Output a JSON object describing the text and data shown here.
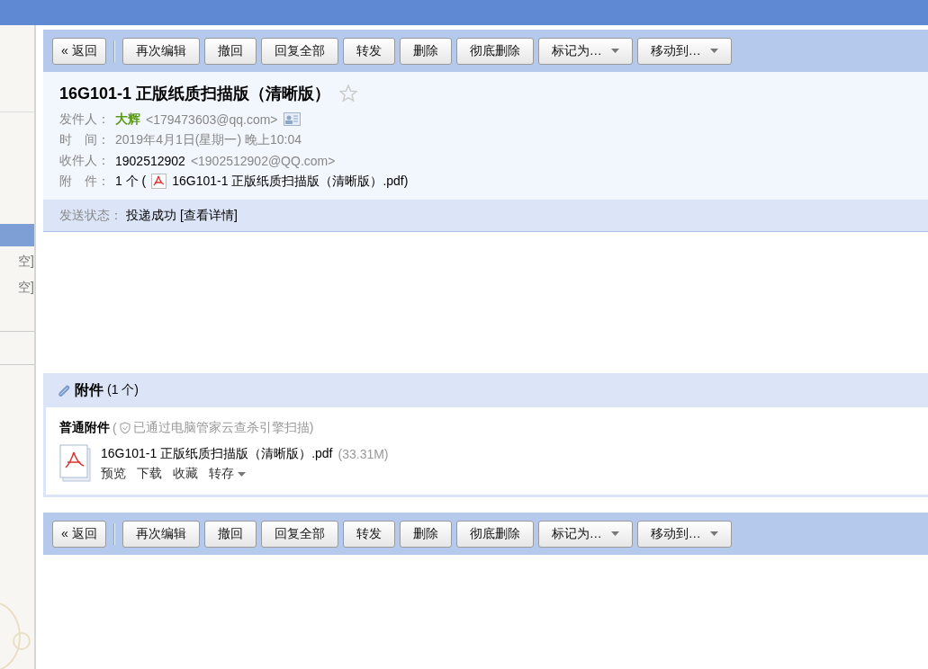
{
  "sidebar": {
    "items": [
      {
        "selected": true
      },
      {
        "label": "空]",
        "selected": false
      },
      {
        "label": "空]",
        "selected": false
      }
    ]
  },
  "top_toolbar": {
    "buttons": [
      {
        "label": "« 返回",
        "kind": "plain"
      },
      {
        "label": "再次编辑",
        "kind": "plain"
      },
      {
        "label": "撤回",
        "kind": "plain"
      },
      {
        "label": "回复全部",
        "kind": "plain"
      },
      {
        "label": "转发",
        "kind": "plain"
      },
      {
        "label": "删除",
        "kind": "plain"
      },
      {
        "label": "彻底删除",
        "kind": "plain"
      },
      {
        "label": "标记为…",
        "kind": "dropdown"
      },
      {
        "label": "移动到…",
        "kind": "dropdown"
      }
    ]
  },
  "mail": {
    "subject": "16G101-1 正版纸质扫描版（清晰版）",
    "starred": false,
    "fields": [
      {
        "kind": "sender",
        "label": "发件人：",
        "name": "大辉",
        "address": "<179473603@qq.com>"
      },
      {
        "kind": "time",
        "label": "时　间：",
        "value": "2019年4月1日(星期一) 晚上10:04"
      },
      {
        "kind": "recipient",
        "label": "收件人：",
        "name": "1902512902",
        "address": "<1902512902@QQ.com>"
      },
      {
        "kind": "attachment",
        "label": "附　件：",
        "count": "1 个 (",
        "file": "16G101-1 正版纸质扫描版（清晰版）.pdf)"
      }
    ],
    "status": {
      "label": "发送状态：",
      "value": "投递成功",
      "link": "[查看详情]"
    }
  },
  "attachments": {
    "title": "附件",
    "count": "(1 个)",
    "group": "普通附件",
    "scan_prefix": "(",
    "scan_note": "已通过电脑管家云查杀引擎扫描)",
    "files": [
      {
        "name": "16G101-1 正版纸质扫描版（清晰版）.pdf",
        "size": "(33.31M)",
        "actions": [
          {
            "label": "预览",
            "kind": "link"
          },
          {
            "label": "下载",
            "kind": "link"
          },
          {
            "label": "收藏",
            "kind": "link"
          },
          {
            "label": "转存",
            "kind": "dropdown"
          }
        ]
      }
    ]
  },
  "bottom_toolbar": {
    "buttons": [
      {
        "label": "« 返回",
        "kind": "plain"
      },
      {
        "label": "再次编辑",
        "kind": "plain"
      },
      {
        "label": "撤回",
        "kind": "plain"
      },
      {
        "label": "回复全部",
        "kind": "plain"
      },
      {
        "label": "转发",
        "kind": "plain"
      },
      {
        "label": "删除",
        "kind": "plain"
      },
      {
        "label": "彻底删除",
        "kind": "plain"
      },
      {
        "label": "标记为…",
        "kind": "dropdown"
      },
      {
        "label": "移动到…",
        "kind": "dropdown"
      }
    ]
  }
}
